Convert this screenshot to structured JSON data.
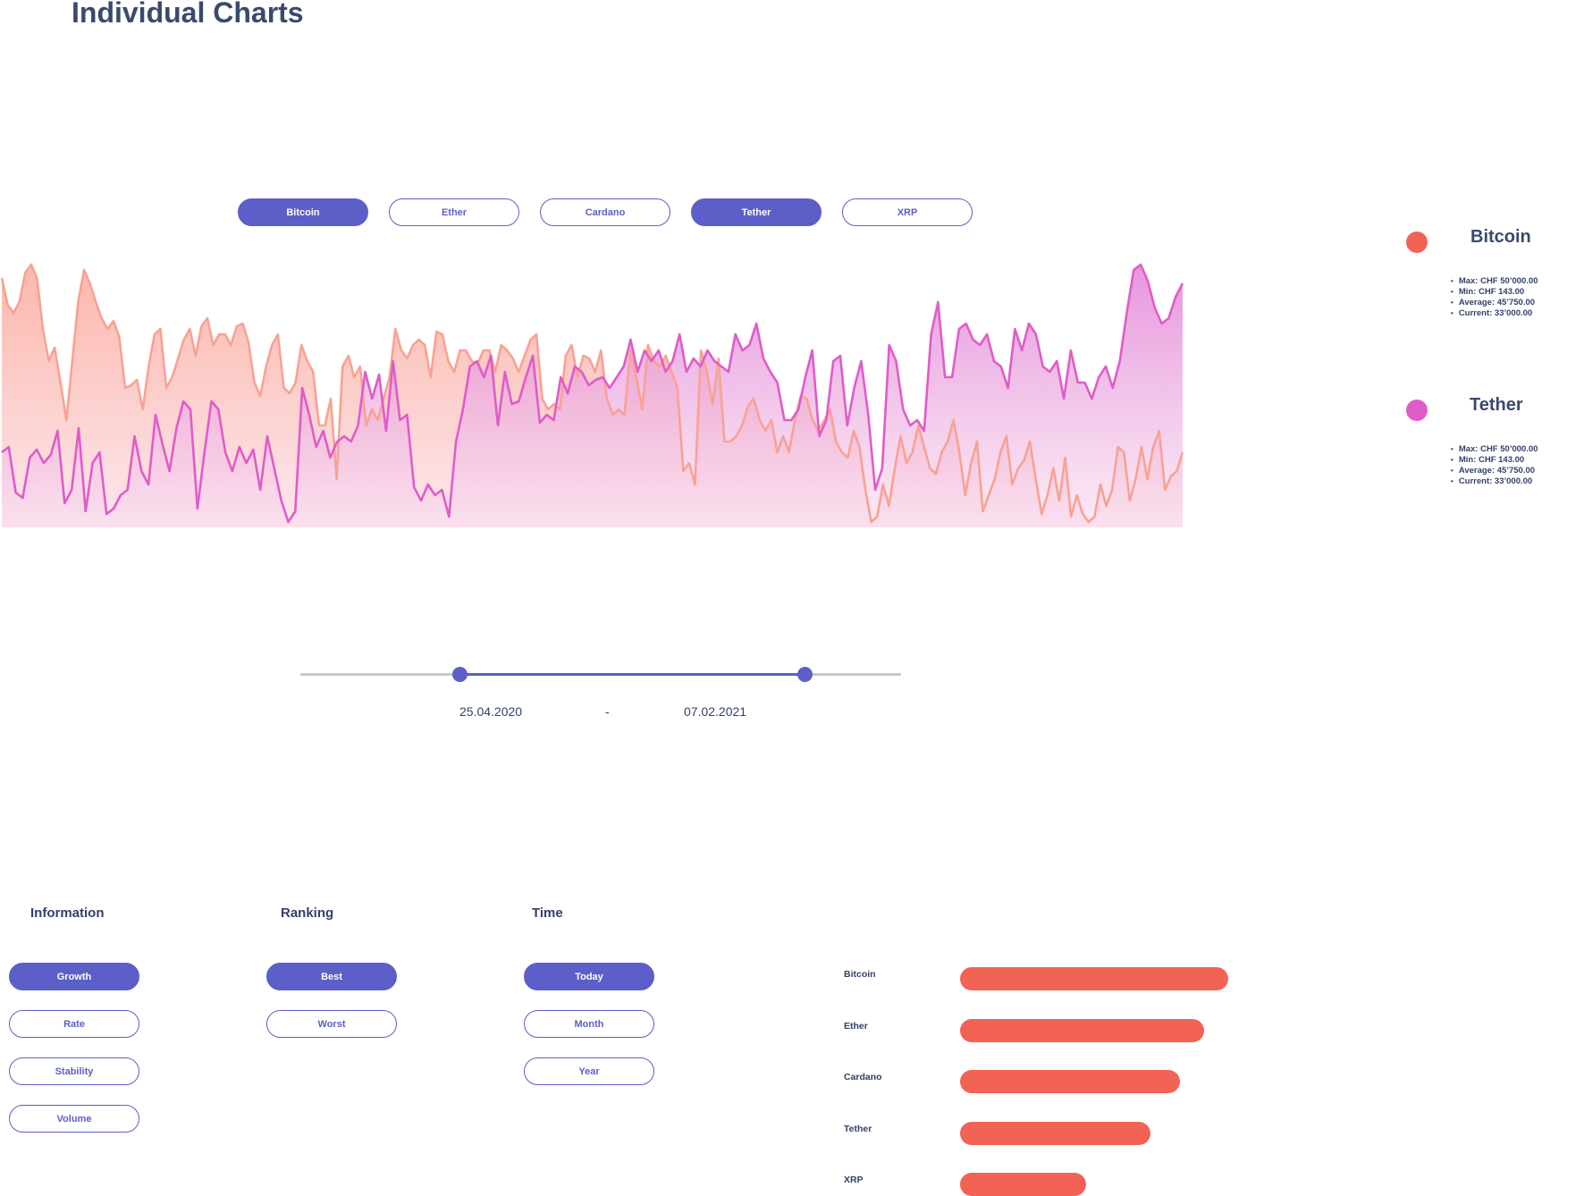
{
  "page_title": "Individual Charts",
  "asset_tabs": [
    {
      "label": "Bitcoin",
      "active": true
    },
    {
      "label": "Ether",
      "active": false
    },
    {
      "label": "Cardano",
      "active": false
    },
    {
      "label": "Tether",
      "active": true
    },
    {
      "label": "XRP",
      "active": false
    }
  ],
  "legend": [
    {
      "name": "Bitcoin",
      "color": "#f26355",
      "stats": [
        "Max: CHF 50’000.00",
        "Min: CHF 143.00",
        "Average: 45’750.00",
        "Current: 33’000.00"
      ]
    },
    {
      "name": "Tether",
      "color": "#e05cc9",
      "stats": [
        "Max: CHF 50’000.00",
        "Min: CHF 143.00",
        "Average: 45’750.00",
        "Current: 33’000.00"
      ]
    }
  ],
  "date_range": {
    "start": "25.04.2020",
    "separator": "-",
    "end": "07.02.2021",
    "start_fraction": 0.265,
    "end_fraction": 0.84
  },
  "filters": {
    "information": {
      "title": "Information",
      "options": [
        {
          "label": "Growth",
          "active": true
        },
        {
          "label": "Rate",
          "active": false
        },
        {
          "label": "Stability",
          "active": false
        },
        {
          "label": "Volume",
          "active": false
        }
      ]
    },
    "ranking": {
      "title": "Ranking",
      "options": [
        {
          "label": "Best",
          "active": true
        },
        {
          "label": "Worst",
          "active": false
        }
      ]
    },
    "time": {
      "title": "Time",
      "options": [
        {
          "label": "Today",
          "active": true
        },
        {
          "label": "Month",
          "active": false
        },
        {
          "label": "Year",
          "active": false
        }
      ]
    }
  },
  "chart_data": [
    {
      "type": "area",
      "title": "",
      "xlabel": "",
      "ylabel": "",
      "ylim": [
        0,
        100
      ],
      "grid": false,
      "series": [
        {
          "name": "Bitcoin",
          "color": "#f8a294",
          "values": [
            93,
            83,
            80,
            84,
            95,
            98,
            93,
            74,
            62,
            67,
            54,
            40,
            62,
            84,
            96,
            91,
            84,
            78,
            74,
            77,
            71,
            52,
            53,
            55,
            44,
            60,
            72,
            74,
            52,
            56,
            63,
            70,
            74,
            64,
            75,
            78,
            68,
            72,
            72,
            68,
            75,
            76,
            69,
            54,
            49,
            60,
            68,
            72,
            52,
            50,
            54,
            68,
            62,
            58,
            38,
            38,
            48,
            18,
            60,
            64,
            56,
            60,
            38,
            44,
            40,
            48,
            56,
            74,
            66,
            63,
            68,
            70,
            68,
            56,
            73,
            72,
            62,
            58,
            66,
            66,
            62,
            61,
            66,
            66,
            58,
            68,
            66,
            63,
            58,
            64,
            70,
            72,
            48,
            44,
            46,
            44,
            64,
            68,
            56,
            64,
            63,
            58,
            66,
            48,
            42,
            44,
            42,
            66,
            56,
            44,
            68,
            62,
            60,
            64,
            58,
            52,
            21,
            24,
            16,
            66,
            58,
            46,
            63,
            32,
            32,
            34,
            38,
            45,
            48,
            40,
            36,
            40,
            28,
            34,
            28,
            40,
            49,
            48,
            40,
            36,
            40,
            44,
            32,
            28,
            26,
            36,
            30,
            14,
            2,
            4,
            16,
            8,
            22,
            34,
            24,
            28,
            38,
            30,
            22,
            20,
            28,
            32,
            40,
            28,
            12,
            24,
            32,
            6,
            12,
            18,
            28,
            34,
            16,
            22,
            25,
            32,
            18,
            5,
            12,
            22,
            10,
            26,
            4,
            12,
            5,
            2,
            4,
            16,
            8,
            14,
            30,
            28,
            10,
            18,
            30,
            18,
            30,
            36,
            14,
            19,
            21,
            28
          ]
        },
        {
          "name": "Tether",
          "color": "#e05cc9",
          "values": [
            28,
            30,
            13,
            11,
            26,
            29,
            24,
            27,
            36,
            9,
            14,
            37,
            6,
            24,
            28,
            5,
            7,
            12,
            14,
            34,
            21,
            16,
            42,
            31,
            21,
            37,
            47,
            44,
            7,
            28,
            47,
            44,
            28,
            21,
            30,
            24,
            29,
            14,
            34,
            22,
            10,
            2,
            6,
            52,
            42,
            30,
            36,
            26,
            32,
            34,
            32,
            38,
            58,
            48,
            57,
            36,
            62,
            40,
            42,
            15,
            10,
            16,
            12,
            14,
            4,
            32,
            44,
            60,
            62,
            56,
            64,
            38,
            58,
            46,
            47,
            56,
            64,
            39,
            42,
            40,
            56,
            50,
            60,
            58,
            53,
            55,
            56,
            52,
            56,
            60,
            70,
            58,
            66,
            62,
            66,
            58,
            62,
            72,
            58,
            63,
            60,
            66,
            62,
            60,
            58,
            72,
            66,
            68,
            76,
            63,
            58,
            54,
            40,
            40,
            44,
            56,
            66,
            34,
            40,
            62,
            64,
            38,
            52,
            62,
            42,
            14,
            22,
            68,
            62,
            44,
            38,
            40,
            36,
            72,
            84,
            56,
            56,
            74,
            76,
            70,
            68,
            72,
            62,
            60,
            52,
            74,
            66,
            76,
            72,
            60,
            58,
            62,
            48,
            66,
            54,
            54,
            48,
            56,
            60,
            52,
            62,
            80,
            96,
            98,
            92,
            82,
            76,
            78,
            86,
            91
          ]
        }
      ]
    },
    {
      "type": "bar",
      "title": "",
      "orientation": "horizontal",
      "categories": [
        "Bitcoin",
        "Ether",
        "Cardano",
        "Tether",
        "XRP"
      ],
      "values": [
        100,
        91,
        82,
        71,
        47
      ],
      "xlim": [
        0,
        100
      ],
      "grid": false,
      "color": "#f26355"
    }
  ]
}
